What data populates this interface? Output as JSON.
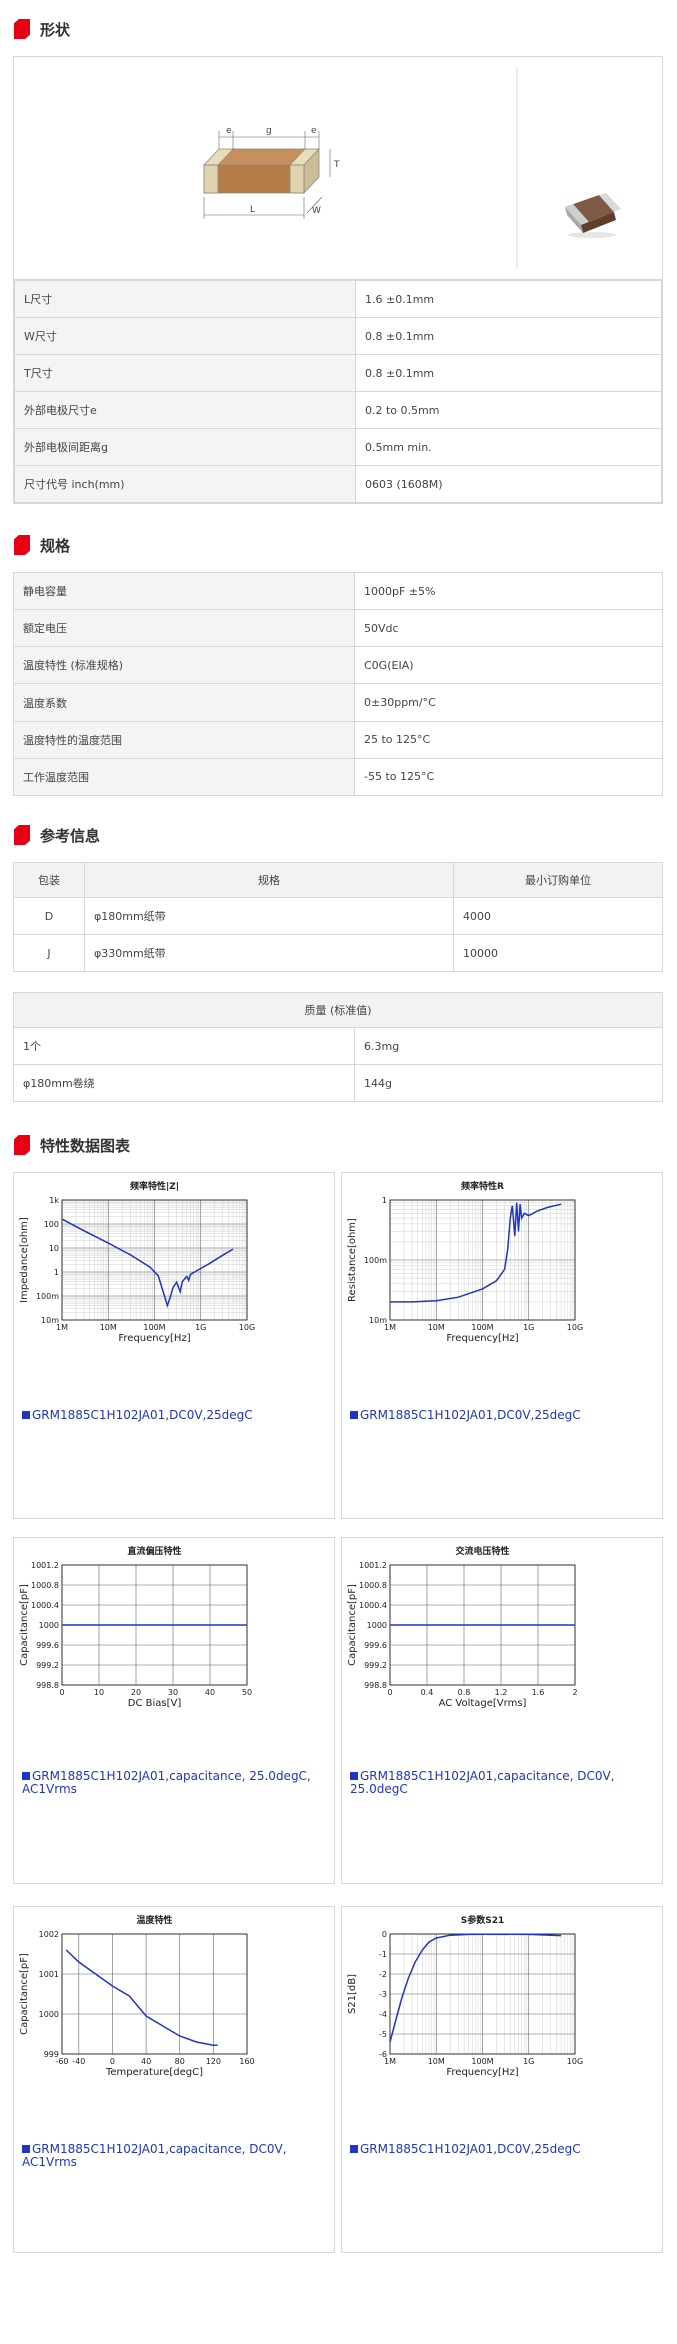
{
  "sections": {
    "shape": "形状",
    "specs": "规格",
    "ref": "参考信息",
    "charts": "特性数据图表"
  },
  "diagram_labels": {
    "e1": "e",
    "g": "g",
    "e2": "e",
    "T": "T",
    "L": "L",
    "W": "W"
  },
  "dimensions": [
    {
      "label": "L尺寸",
      "value": "1.6 ±0.1mm"
    },
    {
      "label": "W尺寸",
      "value": "0.8 ±0.1mm"
    },
    {
      "label": "T尺寸",
      "value": "0.8 ±0.1mm"
    },
    {
      "label": "外部电极尺寸e",
      "value": "0.2 to 0.5mm"
    },
    {
      "label": "外部电极间距离g",
      "value": "0.5mm min."
    },
    {
      "label": "尺寸代号 inch(mm)",
      "value": "0603 (1608M)"
    }
  ],
  "specs": [
    {
      "label": "静电容量",
      "value": "1000pF ±5%"
    },
    {
      "label": "额定电压",
      "value": "50Vdc"
    },
    {
      "label": "温度特性 (标准规格)",
      "value": "C0G(EIA)"
    },
    {
      "label": "温度系数",
      "value": "0±30ppm/°C"
    },
    {
      "label": "温度特性的温度范围",
      "value": "25 to 125°C"
    },
    {
      "label": "工作温度范围",
      "value": "-55 to 125°C"
    }
  ],
  "packaging": {
    "headers": [
      "包装",
      "规格",
      "最小订购单位"
    ],
    "rows": [
      [
        "D",
        "φ180mm纸带",
        "4000"
      ],
      [
        "J",
        "φ330mm纸带",
        "10000"
      ]
    ]
  },
  "mass": {
    "header": "质量 (标准值)",
    "rows": [
      [
        "1个",
        "6.3mg"
      ],
      [
        "φ180mm卷绕",
        "144g"
      ]
    ]
  },
  "chart_data": [
    {
      "type": "line",
      "title": "频率特性|Z|",
      "xlabel": "Frequency[Hz]",
      "ylabel": "Impedance[ohm]",
      "xscale": "log",
      "yscale": "log",
      "xlim": [
        1000000.0,
        10000000000.0
      ],
      "ylim": [
        0.01,
        1000
      ],
      "xticks": [
        "1M",
        "10M",
        "100M",
        "1G",
        "10G"
      ],
      "yticks": [
        "1k",
        "100",
        "10",
        "1",
        "100m",
        "10m"
      ],
      "series": [
        {
          "name": "GRM1885C1H102JA01,DC0V,25degC",
          "x": [
            1000000.0,
            3000000.0,
            10000000.0,
            30000000.0,
            80000000.0,
            120000000.0,
            160000000.0,
            190000000.0,
            220000000.0,
            250000000.0,
            300000000.0,
            360000000.0,
            400000000.0,
            500000000.0,
            550000000.0,
            600000000.0,
            800000000.0,
            1500000000.0,
            3000000000.0,
            5000000000.0
          ],
          "y": [
            160,
            52,
            16,
            5.2,
            1.6,
            0.7,
            0.12,
            0.04,
            0.09,
            0.22,
            0.38,
            0.15,
            0.4,
            0.65,
            0.45,
            0.8,
            1.1,
            2.2,
            5,
            9
          ]
        }
      ]
    },
    {
      "type": "line",
      "title": "频率特性R",
      "xlabel": "Frequency[Hz]",
      "ylabel": "Resistance[ohm]",
      "xscale": "log",
      "yscale": "log",
      "xlim": [
        1000000.0,
        10000000000.0
      ],
      "ylim": [
        0.01,
        1
      ],
      "xticks": [
        "1M",
        "10M",
        "100M",
        "1G",
        "10G"
      ],
      "yticks": [
        "1",
        "100m",
        "10m"
      ],
      "series": [
        {
          "name": "GRM1885C1H102JA01,DC0V,25degC",
          "x": [
            1000000.0,
            3000000.0,
            10000000.0,
            30000000.0,
            100000000.0,
            200000000.0,
            300000000.0,
            350000000.0,
            400000000.0,
            440000000.0,
            500000000.0,
            550000000.0,
            600000000.0,
            650000000.0,
            700000000.0,
            800000000.0,
            1000000000.0,
            1500000000.0,
            2500000000.0,
            5000000000.0
          ],
          "y": [
            0.02,
            0.02,
            0.021,
            0.024,
            0.033,
            0.045,
            0.07,
            0.15,
            0.5,
            0.8,
            0.25,
            0.9,
            0.3,
            0.85,
            0.5,
            0.6,
            0.55,
            0.65,
            0.75,
            0.85
          ]
        }
      ]
    },
    {
      "type": "line",
      "title": "直流偏压特性",
      "xlabel": "DC Bias[V]",
      "ylabel": "Capacitance[pF]",
      "xlim": [
        0,
        50
      ],
      "ylim": [
        998.8,
        1001.2
      ],
      "xticks": [
        "0",
        "10",
        "20",
        "30",
        "40",
        "50"
      ],
      "yticks": [
        "1001.2",
        "1000.8",
        "1000.4",
        "1000",
        "999.6",
        "999.2",
        "998.8"
      ],
      "series": [
        {
          "name": "GRM1885C1H102JA01,capacitance, 25.0degC, AC1Vrms",
          "x": [
            0,
            50
          ],
          "y": [
            1000,
            1000
          ]
        }
      ]
    },
    {
      "type": "line",
      "title": "交流电压特性",
      "xlabel": "AC Voltage[Vrms]",
      "ylabel": "Capacitance[pF]",
      "xlim": [
        0,
        2
      ],
      "ylim": [
        998.8,
        1001.2
      ],
      "xticks": [
        "0",
        "0.4",
        "0.8",
        "1.2",
        "1.6",
        "2"
      ],
      "yticks": [
        "1001.2",
        "1000.8",
        "1000.4",
        "1000",
        "999.6",
        "999.2",
        "998.8"
      ],
      "series": [
        {
          "name": "GRM1885C1H102JA01,capacitance, DC0V, 25.0degC",
          "x": [
            0,
            2
          ],
          "y": [
            1000,
            1000
          ]
        }
      ]
    },
    {
      "type": "line",
      "title": "温度特性",
      "xlabel": "Temperature[degC]",
      "ylabel": "Capacitance[pF]",
      "xlim": [
        -60,
        160
      ],
      "ylim": [
        999,
        1002
      ],
      "xticks": [
        "-60",
        "-40",
        "0",
        "40",
        "80",
        "120",
        "160"
      ],
      "yticks": [
        "1002",
        "1001",
        "1000",
        "999"
      ],
      "series": [
        {
          "name": "GRM1885C1H102JA01,capacitance, DC0V, AC1Vrms",
          "x": [
            -55,
            -40,
            -20,
            0,
            20,
            40,
            60,
            80,
            100,
            120,
            125
          ],
          "y": [
            1001.6,
            1001.3,
            1001.0,
            1000.7,
            1000.45,
            999.95,
            999.7,
            999.45,
            999.3,
            999.22,
            999.22
          ]
        }
      ]
    },
    {
      "type": "line",
      "title": "S参数S21",
      "xlabel": "Frequency[Hz]",
      "ylabel": "S21[dB]",
      "xscale": "log",
      "xlim": [
        1000000.0,
        10000000000.0
      ],
      "ylim": [
        -6,
        0
      ],
      "xticks": [
        "1M",
        "10M",
        "100M",
        "1G",
        "10G"
      ],
      "yticks": [
        "0",
        "-1",
        "-2",
        "-3",
        "-4",
        "-5",
        "-6"
      ],
      "series": [
        {
          "name": "GRM1885C1H102JA01,DC0V,25degC",
          "x": [
            1000000.0,
            1300000.0,
            1800000.0,
            2500000.0,
            3500000.0,
            5000000.0,
            7000000.0,
            10000000.0,
            20000000.0,
            50000000.0,
            100000000.0,
            1000000000.0,
            5000000000.0
          ],
          "y": [
            -5.4,
            -4.4,
            -3.2,
            -2.2,
            -1.4,
            -0.8,
            -0.4,
            -0.2,
            -0.06,
            -0.02,
            -0.01,
            -0.02,
            -0.08
          ]
        }
      ]
    }
  ]
}
